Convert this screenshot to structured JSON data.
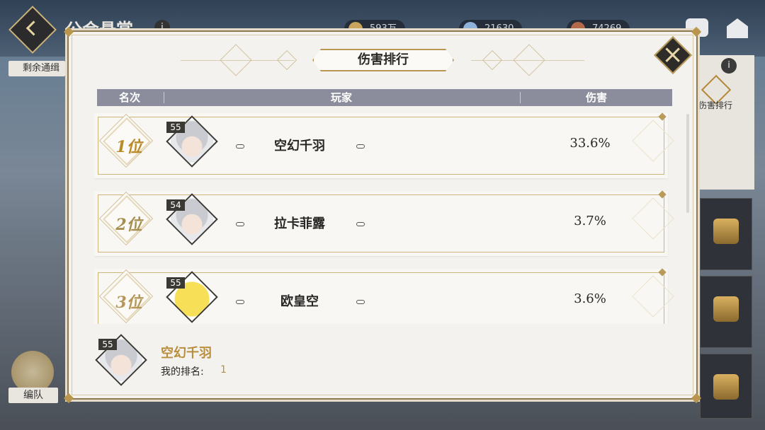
{
  "background": {
    "title": "公会悬赏",
    "resources": [
      {
        "value": "593万",
        "icon": "coin-icon"
      },
      {
        "value": "21630",
        "icon": "crystal-icon"
      },
      {
        "value": "74269",
        "icon": "ticket-icon"
      }
    ],
    "remaining_label": "剩余通缉",
    "team_label": "编队",
    "side_label": "伤害排行"
  },
  "modal": {
    "title": "伤害排行",
    "columns": {
      "rank": "名次",
      "player": "玩家",
      "damage": "伤害"
    },
    "rows": [
      {
        "rank": "1位",
        "level": "55",
        "name": "空幻千羽",
        "damage": "33.6%",
        "avatar": "silver-hair"
      },
      {
        "rank": "2位",
        "level": "54",
        "name": "拉卡菲露",
        "damage": "3.7%",
        "avatar": "silver-hair"
      },
      {
        "rank": "3位",
        "level": "55",
        "name": "欧皇空",
        "damage": "3.6%",
        "avatar": "yellow-creature"
      }
    ],
    "me": {
      "level": "55",
      "name": "空幻千羽",
      "rank_label": "我的排名:",
      "rank_value": "1"
    }
  },
  "colors": {
    "accent": "#b88e3c",
    "header_bar": "#8b8d9c",
    "panel": "#f3f2ef"
  }
}
